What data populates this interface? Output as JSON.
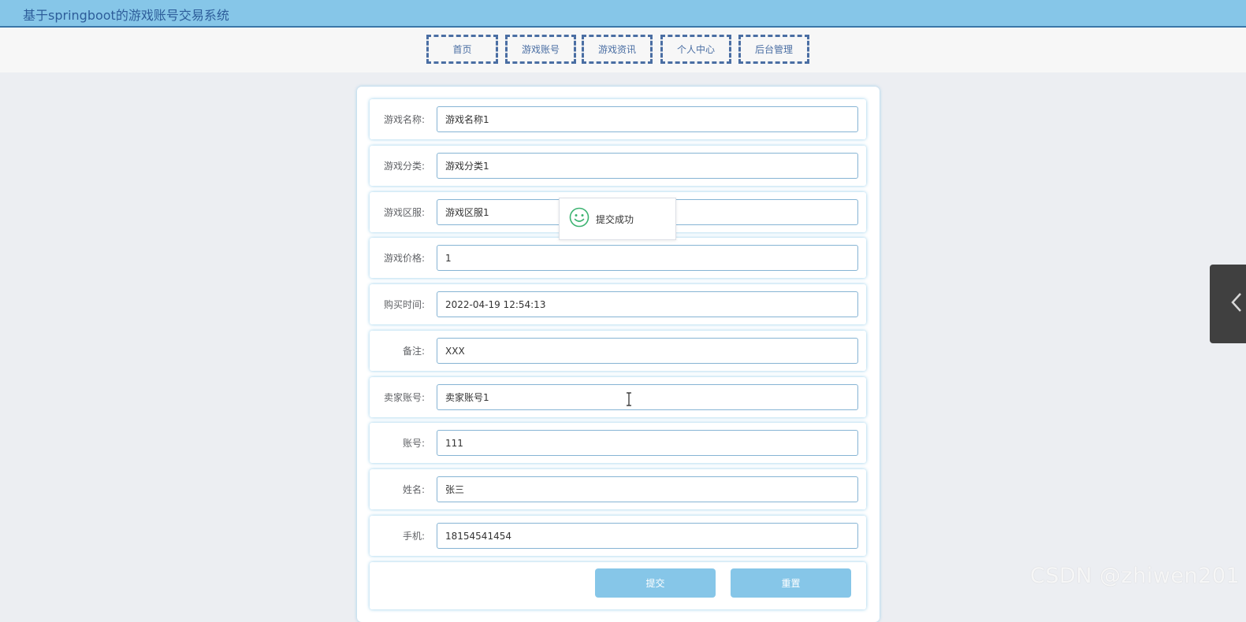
{
  "header": {
    "title": "基于springboot的游戏账号交易系统"
  },
  "nav": {
    "items": [
      {
        "label": "首页"
      },
      {
        "label": "游戏账号"
      },
      {
        "label": "游戏资讯"
      },
      {
        "label": "个人中心"
      },
      {
        "label": "后台管理"
      }
    ]
  },
  "form": {
    "fields": [
      {
        "label": "游戏名称:",
        "value": "游戏名称1"
      },
      {
        "label": "游戏分类:",
        "value": "游戏分类1"
      },
      {
        "label": "游戏区服:",
        "value": "游戏区服1"
      },
      {
        "label": "游戏价格:",
        "value": "1"
      },
      {
        "label": "购买时间:",
        "value": "2022-04-19 12:54:13"
      },
      {
        "label": "备注:",
        "value": "XXX"
      },
      {
        "label": "卖家账号:",
        "value": "卖家账号1"
      },
      {
        "label": "账号:",
        "value": "111"
      },
      {
        "label": "姓名:",
        "value": "张三"
      },
      {
        "label": "手机:",
        "value": "18154541454"
      }
    ],
    "submit_label": "提交",
    "reset_label": "重置"
  },
  "toast": {
    "message": "提交成功",
    "icon": "smile-icon"
  },
  "side_tab": {
    "icon": "chevron-left-icon"
  },
  "watermark": {
    "text": "CSDN @zhiwen201"
  },
  "colors": {
    "header_bg": "#86c6e8",
    "header_text": "#2d5d9a",
    "nav_border": "#4a6ea3",
    "button_bg": "#86c6e8",
    "success_icon": "#3cb371"
  }
}
